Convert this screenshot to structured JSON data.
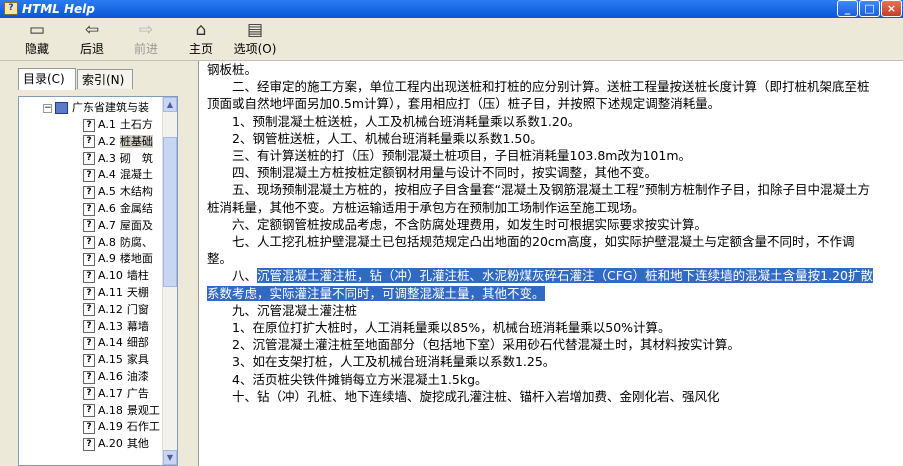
{
  "window": {
    "title": "HTML Help",
    "icon_name": "help-book-icon",
    "minimize": "_",
    "maximize": "□",
    "close": "×"
  },
  "toolbar": {
    "hide": "隐藏",
    "back": "后退",
    "forward": "前进",
    "home": "主页",
    "options": "选项(O)"
  },
  "tabs": {
    "contents": "目录(C)",
    "index": "索引(N)"
  },
  "tree": {
    "root": "广东省建筑与装",
    "items": [
      {
        "code": "A.1",
        "name": "土石方"
      },
      {
        "code": "A.2",
        "name": "桩基础"
      },
      {
        "code": "A.3",
        "name": "砌　筑"
      },
      {
        "code": "A.4",
        "name": "混凝土"
      },
      {
        "code": "A.5",
        "name": "木结构"
      },
      {
        "code": "A.6",
        "name": "金属结"
      },
      {
        "code": "A.7",
        "name": "屋面及"
      },
      {
        "code": "A.8",
        "name": "防腐、"
      },
      {
        "code": "A.9",
        "name": "楼地面"
      },
      {
        "code": "A.10",
        "name": "墙柱"
      },
      {
        "code": "A.11",
        "name": "天棚"
      },
      {
        "code": "A.12",
        "name": "门窗"
      },
      {
        "code": "A.13",
        "name": "幕墙"
      },
      {
        "code": "A.14",
        "name": "细部"
      },
      {
        "code": "A.15",
        "name": "家具"
      },
      {
        "code": "A.16",
        "name": "油漆"
      },
      {
        "code": "A.17",
        "name": "广告"
      },
      {
        "code": "A.18",
        "name": "景观工"
      },
      {
        "code": "A.19",
        "name": "石作工"
      },
      {
        "code": "A.20",
        "name": "其他"
      }
    ]
  },
  "content": {
    "lines": [
      "钢板桩。",
      "　　二、经审定的施工方案，单位工程内出现送桩和打桩的应分别计算。送桩工程量按送桩长度计算（即打桩机架底至桩顶面或自然地坪面另加0.5m计算），套用相应打（压）桩子目，并按照下述规定调整消耗量。",
      "　　1、预制混凝土桩送桩，人工及机械台班消耗量乘以系数1.20。",
      "　　2、钢管桩送桩，人工、机械台班消耗量乘以系数1.50。",
      "　　三、有计算送桩的打（压）预制混凝土桩项目，子目桩消耗量103.8m改为101m。",
      "　　四、预制混凝土方桩按桩定额钢材用量与设计不同时，按实调整，其他不变。",
      "　　五、现场预制混凝土方桩的，按相应子目含量套“混凝土及钢筋混凝土工程”预制方桩制作子目，扣除子目中混凝土方桩消耗量，其他不变。方桩运输适用于承包方在预制加工场制作运至施工现场。",
      "　　六、定额钢管桩按成品考虑，不含防腐处理费用，如发生时可根据实际要求按实计算。",
      "　　七、人工挖孔桩护壁混凝土已包括规范规定凸出地面的20cm高度，如实际护壁混凝土与定额含量不同时，不作调整。"
    ],
    "highlight_prefix": "　　八、",
    "highlight_text": "沉管混凝土灌注桩，钻（冲）孔灌注桩、水泥粉煤灰碎石灌注（CFG）桩和地下连续墙的混凝土含量按1.20扩散系数考虑，实际灌注量不同时，可调整混凝土量，其他不变。",
    "after_lines": [
      "　　九、沉管混凝土灌注桩",
      "　　1、在原位打扩大桩时，人工消耗量乘以85%，机械台班消耗量乘以50%计算。",
      "　　2、沉管混凝土灌注桩至地面部分（包括地下室）采用砂石代替混凝土时，其材料按实计算。",
      "　　3、如在支架打桩，人工及机械台班消耗量乘以系数1.25。",
      "　　4、活页桩尖铁件摊销每立方米混凝土1.5kg。",
      "　　十、钻（冲）孔桩、地下连续墙、旋挖成孔灌注桩、锚杆入岩增加费、金刚化岩、强风化"
    ]
  },
  "colors": {
    "title_bar": "#0A55D8",
    "highlight_bg": "#316AC5"
  }
}
